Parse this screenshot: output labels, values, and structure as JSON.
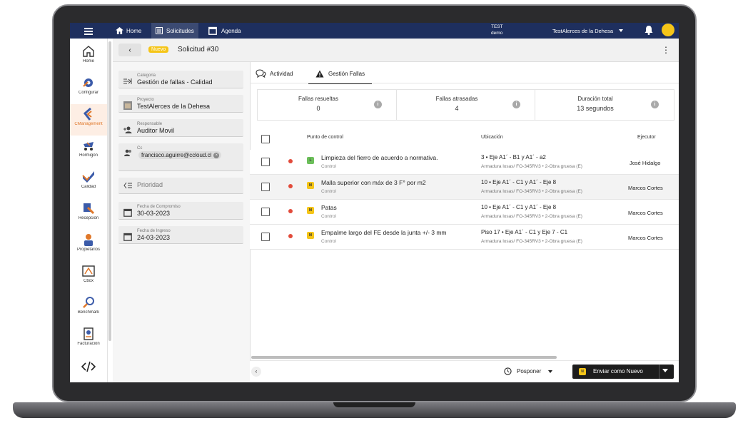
{
  "topbar": {
    "nav": [
      {
        "label": "Home",
        "icon": "home-icon"
      },
      {
        "label": "Solicitudes",
        "icon": "list-icon"
      },
      {
        "label": "Agenda",
        "icon": "calendar-icon"
      }
    ],
    "env_line1": "TEST",
    "env_line2": "demo",
    "project_selector": "TestAlerces de la Dehesa"
  },
  "sidebar": {
    "items": [
      {
        "label": "Home"
      },
      {
        "label": "Configurar"
      },
      {
        "label": "CManagement"
      },
      {
        "label": "Hormigón"
      },
      {
        "label": "Calidad"
      },
      {
        "label": "Recepción"
      },
      {
        "label": "Propietarios"
      },
      {
        "label": "Cbox"
      },
      {
        "label": "Benchmark"
      },
      {
        "label": "Facturación"
      }
    ]
  },
  "header": {
    "status_badge": "Nuevo",
    "title": "Solicitud #30"
  },
  "form": {
    "categoria": {
      "label": "Categoria",
      "value": "Gestión de fallas - Calidad"
    },
    "proyecto": {
      "label": "Proyecto",
      "value": "TestAlerces de la Dehesa"
    },
    "responsable": {
      "label": "Responsable",
      "value": "Auditor Movil"
    },
    "cc": {
      "label": "Cc",
      "value": "francisco.aguirre@ccloud.cl"
    },
    "prioridad": {
      "placeholder": "Prioridad"
    },
    "fecha_compromiso": {
      "label": "Fecha de Compromiso",
      "value": "30-03-2023"
    },
    "fecha_ingreso": {
      "label": "Fecha de Ingreso",
      "value": "24-03-2023"
    }
  },
  "tabs": [
    {
      "label": "Actividad"
    },
    {
      "label": "Gestión Fallas"
    }
  ],
  "stats": [
    {
      "label": "Fallas resueltas",
      "value": "0"
    },
    {
      "label": "Fallas atrasadas",
      "value": "4"
    },
    {
      "label": "Duración total",
      "value": "13 segundos"
    }
  ],
  "table": {
    "columns": {
      "punto": "Punto de control",
      "ubicacion": "Ubicación",
      "ejecutor": "Ejecutor"
    },
    "rows": [
      {
        "level": "L",
        "level_color": "#6cbf5a",
        "name": "Limpieza del fierro de acuerdo a normativa.",
        "type": "Control",
        "loc1": "3 • Eje A1´ - B1 y A1´ - a2",
        "loc2": "Armadura losas/ FO-345RV3 • 2-Obra gruesa (E)",
        "ejecutor": "José Hidalgo"
      },
      {
        "level": "M",
        "level_color": "#f5c518",
        "name": "Malla superior con máx de 3 F° por m2",
        "type": "Control",
        "loc1": "10 • Eje A1´ - C1 y A1´ - Eje 8",
        "loc2": "Armadura losas/ FO-345RV3 • 2-Obra gruesa (E)",
        "ejecutor": "Marcos Cortes"
      },
      {
        "level": "M",
        "level_color": "#f5c518",
        "name": "Patas",
        "type": "Control",
        "loc1": "10 • Eje A1´ - C1 y A1´ - Eje 8",
        "loc2": "Armadura losas/ FO-345RV3 • 2-Obra gruesa (E)",
        "ejecutor": "Marcos Cortes"
      },
      {
        "level": "M",
        "level_color": "#f5c518",
        "name": "Empalme largo del FE desde la junta +/- 3 mm",
        "type": "Control",
        "loc1": "Piso 17 • Eje A1´ - C1 y Eje 7 - C1",
        "loc2": "Armadura losas/ FO-345RV3 • 2-Obra gruesa (E)",
        "ejecutor": "Marcos Cortes"
      }
    ]
  },
  "footer": {
    "posponer_label": "Posponer",
    "send_badge": "N",
    "send_label": "Enviar como Nuevo"
  },
  "colors": {
    "topbar": "#1e2f5e",
    "accent_orange": "#e0782a",
    "badge_yellow": "#f5c518",
    "status_red": "#e24b3b"
  }
}
